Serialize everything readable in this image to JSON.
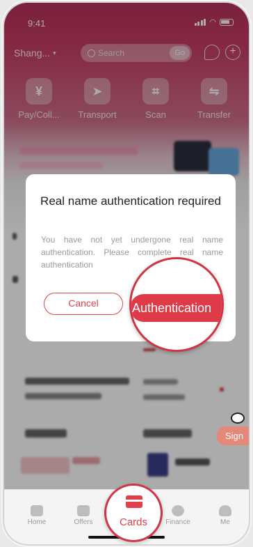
{
  "status_bar": {
    "time": "9:41"
  },
  "top_bar": {
    "city": "Shang...",
    "search_placeholder": "Search",
    "search_go": "Go"
  },
  "quick_actions": [
    {
      "label": "Pay/Coll...",
      "icon": "yuan-icon",
      "glyph": "¥"
    },
    {
      "label": "Transport",
      "icon": "paper-plane-icon",
      "glyph": "➤"
    },
    {
      "label": "Scan",
      "icon": "scan-icon",
      "glyph": "⌗"
    },
    {
      "label": "Transfer",
      "icon": "transfer-icon",
      "glyph": "⇋"
    }
  ],
  "dialog": {
    "title": "Real name authentication required",
    "body": "You have not yet undergone real name authentication. Please complete real name authentication",
    "cancel_label": "Cancel",
    "confirm_label": "Authentication"
  },
  "sign_badge": "Sign",
  "tab_bar": {
    "tabs": [
      {
        "label": "Home"
      },
      {
        "label": "Offers"
      },
      {
        "label": "Cards"
      },
      {
        "label": "Finance"
      },
      {
        "label": "Me"
      }
    ]
  },
  "colors": {
    "brand": "#d8464b",
    "header": "#c53c63"
  }
}
